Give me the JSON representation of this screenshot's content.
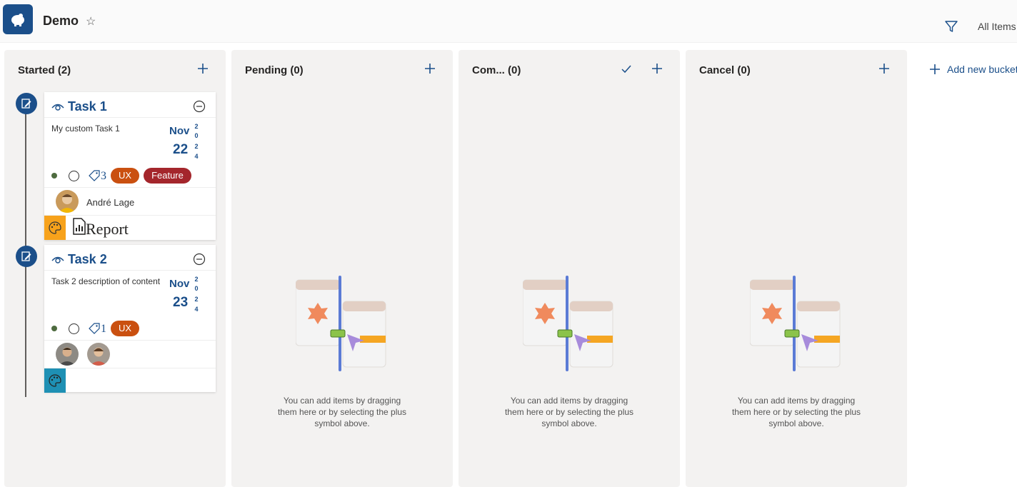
{
  "header": {
    "title": "Demo",
    "star_icon": "star-outline-icon",
    "filter_icon": "filter-icon",
    "view_label": "All Items"
  },
  "buckets": [
    {
      "label": "Started (2)"
    },
    {
      "label": "Pending (0)",
      "empty_text": "You can add items by dragging them here or by selecting the plus symbol above."
    },
    {
      "label": "Com... (0)",
      "empty_text": "You can add items by dragging them here or by selecting the plus symbol above."
    },
    {
      "label": "Cancel (0)",
      "empty_text": "You can add items by dragging them here or by selecting the plus symbol above."
    }
  ],
  "add_bucket_label": "Add new bucket",
  "tasks": [
    {
      "title": "Task 1",
      "description": "My custom Task 1",
      "date": {
        "month": "Nov",
        "day": "22",
        "year": [
          "2",
          "0",
          "2",
          "4"
        ]
      },
      "tag_count": "3",
      "labels": [
        "UX",
        "Feature"
      ],
      "assignee": "André Lage",
      "attachment": "Report"
    },
    {
      "title": "Task 2",
      "description": "Task 2 description of content",
      "date": {
        "month": "Nov",
        "day": "23",
        "year": [
          "2",
          "0",
          "2",
          "4"
        ]
      },
      "tag_count": "1",
      "labels": [
        "UX"
      ]
    }
  ],
  "colors": {
    "accent": "#1b4f8a",
    "bucket_bg": "#f3f2f1",
    "label_ux": "#ca5010",
    "label_feature": "#a4262c",
    "palette_orange": "#f7a21b",
    "palette_teal": "#1e90b4"
  }
}
